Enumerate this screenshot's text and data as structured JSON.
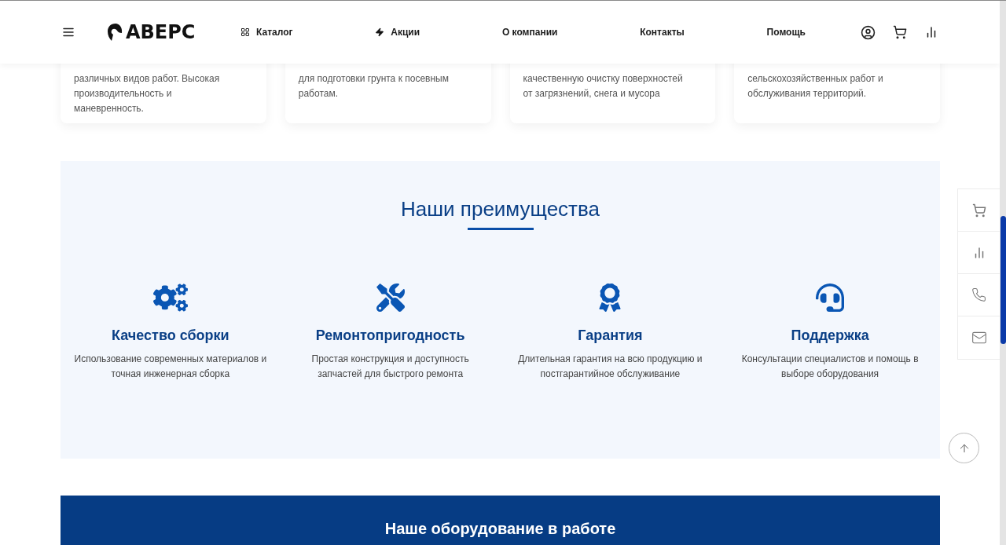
{
  "header": {
    "logo": "АВЕРС",
    "nav": [
      "Каталог",
      "Акции",
      "О компании",
      "Контакты",
      "Помощь"
    ]
  },
  "product_cards": [
    {
      "description": "различных видов работ. Высокая производительность и маневренность."
    },
    {
      "description": "для подготовки грунта к посевным работам."
    },
    {
      "description": "качественную очистку поверхностей от загрязнений, снега и мусора"
    },
    {
      "description": "сельскохозяйственных работ и обслуживания территорий."
    }
  ],
  "advantages": {
    "title": "Наши преимущества",
    "items": [
      {
        "title": "Качество сборки",
        "text": "Использование современных материалов и точная инженерная сборка"
      },
      {
        "title": "Ремонтопригодность",
        "text": "Простая конструкция и доступность запчастей для быстрого ремонта"
      },
      {
        "title": "Гарантия",
        "text": "Длительная гарантия на всю продукцию и постгарантийное обслуживание"
      },
      {
        "title": "Поддержка",
        "text": "Консультации специалистов и помощь в выборе оборудования"
      }
    ]
  },
  "equipment_banner": {
    "title": "Наше оборудование в работе"
  }
}
